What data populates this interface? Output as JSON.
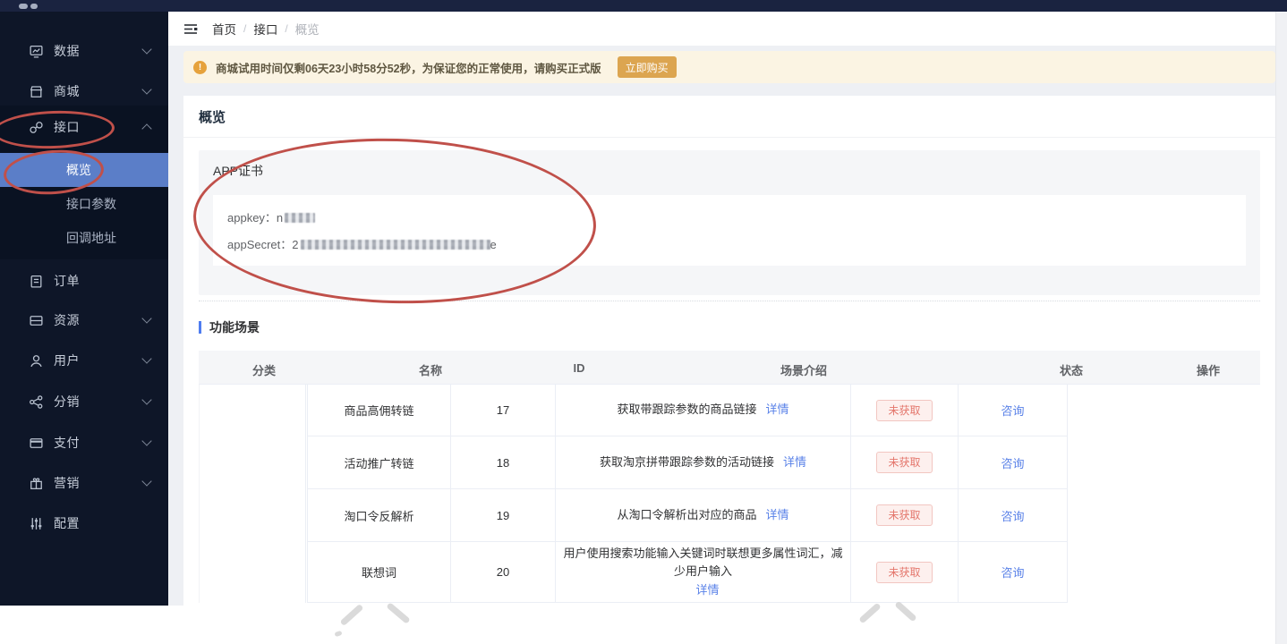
{
  "sidebar": {
    "items": [
      {
        "label": "数据",
        "icon": "monitor-icon"
      },
      {
        "label": "商城",
        "icon": "shop-icon"
      },
      {
        "label": "接口",
        "icon": "link-icon"
      },
      {
        "label": "订单",
        "icon": "order-icon"
      },
      {
        "label": "资源",
        "icon": "resource-icon"
      },
      {
        "label": "用户",
        "icon": "user-icon"
      },
      {
        "label": "分销",
        "icon": "share-icon"
      },
      {
        "label": "支付",
        "icon": "pay-icon"
      },
      {
        "label": "营销",
        "icon": "gift-icon"
      },
      {
        "label": "配置",
        "icon": "sliders-icon"
      }
    ],
    "submenu": [
      {
        "label": "概览",
        "active": true
      },
      {
        "label": "接口参数"
      },
      {
        "label": "回调地址"
      }
    ]
  },
  "breadcrumb": {
    "items": [
      "首页",
      "接口",
      "概览"
    ],
    "separator": "/"
  },
  "banner": {
    "icon": "warning-icon",
    "text": "商城试用时间仅剩06天23小时58分52秒，为保证您的正常使用，请购买正式版",
    "button": "立即购买"
  },
  "main": {
    "title": "概览",
    "cert": {
      "title": "APP证书",
      "appkey_label": "appkey：",
      "appkey_visible": "n",
      "appsecret_label": "appSecret：",
      "appsecret_start": "2",
      "appsecret_end": "e",
      "values_redacted": true
    },
    "section_title": "功能场景",
    "table": {
      "headers": [
        "分类",
        "名称",
        "ID",
        "场景介绍",
        "状态",
        "操作"
      ],
      "detail_label": "详情",
      "rows": [
        {
          "name": "商品高佣转链",
          "id": "17",
          "desc": "获取带跟踪参数的商品链接",
          "status": "未获取",
          "action": "咨询"
        },
        {
          "name": "活动推广转链",
          "id": "18",
          "desc": "获取淘京拼带跟踪参数的活动链接",
          "status": "未获取",
          "action": "咨询"
        },
        {
          "name": "淘口令反解析",
          "id": "19",
          "desc": "从淘口令解析出对应的商品",
          "status": "未获取",
          "action": "咨询"
        },
        {
          "name": "联想词",
          "id": "20",
          "desc": "用户使用搜索功能输入关键词时联想更多属性词汇，减少用户输入",
          "status": "未获取",
          "action": "咨询"
        }
      ]
    }
  },
  "colors": {
    "sidebar_bg": "#0e1628",
    "sidebar_active": "#5b7ec8",
    "topbar_bg": "#1a2340",
    "link_blue": "#5a82e8",
    "banner_bg": "#fbf4e3",
    "banner_icon": "#e6a23c",
    "buy_button": "#dca550",
    "badge_text": "#e4766c",
    "badge_bg": "#fdf0ee",
    "annotation_red": "#c0504a",
    "section_bar_blue": "#4f7df0"
  }
}
